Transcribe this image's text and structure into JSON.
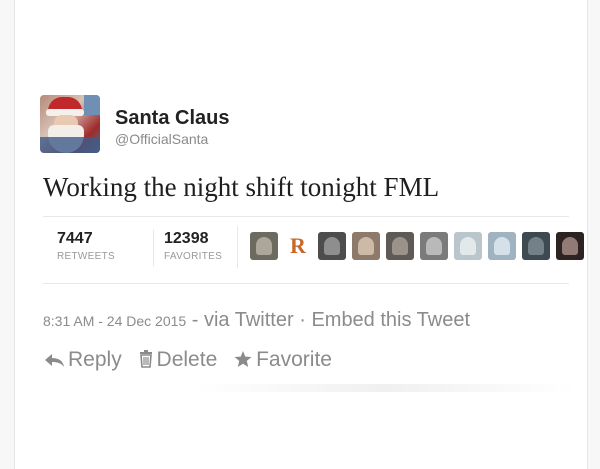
{
  "tweet": {
    "author_name": "Santa Claus",
    "author_handle": "@OfficialSanta",
    "text": "Working the night shift tonight FML"
  },
  "stats": {
    "retweets_count": "7447",
    "retweets_label": "RETWEETS",
    "favorites_count": "12398",
    "favorites_label": "FAVORITES"
  },
  "favoriters": [
    {
      "icon": "user-avatar",
      "color": "#6d6a60"
    },
    {
      "icon": "r-letter-avatar",
      "letter": "R",
      "color": "#c8692a"
    },
    {
      "icon": "user-avatar",
      "color": "#4d4d4f"
    },
    {
      "icon": "user-avatar",
      "color": "#8d7a6a"
    },
    {
      "icon": "user-avatar",
      "color": "#5f5a55"
    },
    {
      "icon": "user-avatar",
      "color": "#7b7b7b"
    },
    {
      "icon": "user-avatar",
      "color": "#b9c6cc"
    },
    {
      "icon": "user-avatar",
      "color": "#9fb4c0"
    },
    {
      "icon": "user-avatar",
      "color": "#3e4a52"
    },
    {
      "icon": "user-avatar",
      "color": "#2c2322"
    }
  ],
  "meta": {
    "timestamp": "8:31 AM - 24 Dec 2015",
    "dash": " - ",
    "via": "via Twitter",
    "dot": " · ",
    "embed": "Embed this Tweet"
  },
  "actions": {
    "reply": "Reply",
    "delete": "Delete",
    "favorite": "Favorite"
  },
  "colors": {
    "name": "#222222",
    "muted": "#8b8b8b",
    "r_accent": "#c8692a"
  }
}
